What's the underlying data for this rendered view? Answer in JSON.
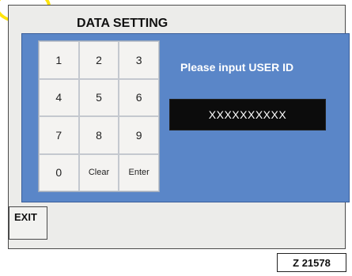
{
  "screen": {
    "title": "DATA SETTING",
    "keypad": {
      "keys": [
        "1",
        "2",
        "3",
        "4",
        "5",
        "6",
        "7",
        "8",
        "9",
        "0",
        "Clear",
        "Enter"
      ]
    },
    "prompt": "Please input USER  ID",
    "user_id_value": "XXXXXXXXXX",
    "exit_label": "EXIT"
  },
  "figure_code": "Z 21578",
  "colors": {
    "panel_blue": "#5a86c8",
    "field_black": "#0c0c0c",
    "highlight_yellow": "#ffe40a"
  }
}
